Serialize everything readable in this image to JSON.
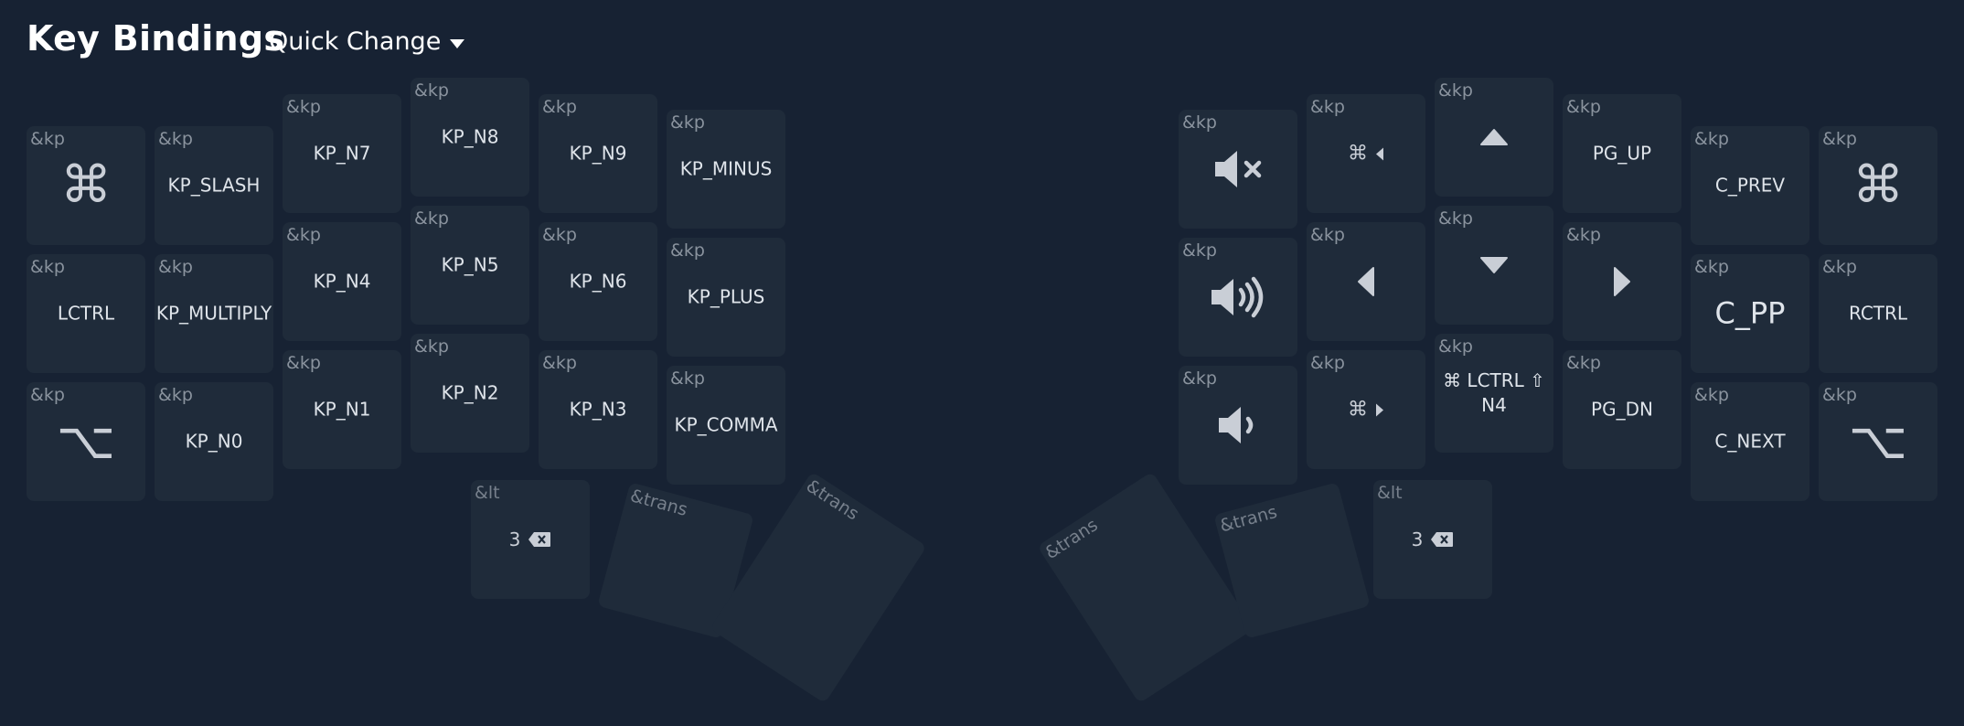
{
  "header": {
    "title": "Key Bindings",
    "quick_change": "Quick Change"
  },
  "keys": {
    "l_r0c0": {
      "bind": "&kp",
      "icon": "command-icon"
    },
    "l_r0c1": {
      "bind": "&kp",
      "label": "KP_SLASH"
    },
    "l_r0c2": {
      "bind": "&kp",
      "label": "KP_N7"
    },
    "l_r0c3": {
      "bind": "&kp",
      "label": "KP_N8"
    },
    "l_r0c4": {
      "bind": "&kp",
      "label": "KP_N9"
    },
    "l_r0c5": {
      "bind": "&kp",
      "label": "KP_MINUS"
    },
    "l_r1c0": {
      "bind": "&kp",
      "label": "LCTRL"
    },
    "l_r1c1": {
      "bind": "&kp",
      "label": "KP_MULTIPLY"
    },
    "l_r1c2": {
      "bind": "&kp",
      "label": "KP_N4"
    },
    "l_r1c3": {
      "bind": "&kp",
      "label": "KP_N5"
    },
    "l_r1c4": {
      "bind": "&kp",
      "label": "KP_N6"
    },
    "l_r1c5": {
      "bind": "&kp",
      "label": "KP_PLUS"
    },
    "l_r2c0": {
      "bind": "&kp",
      "icon": "option-icon"
    },
    "l_r2c1": {
      "bind": "&kp",
      "label": "KP_N0"
    },
    "l_r2c2": {
      "bind": "&kp",
      "label": "KP_N1"
    },
    "l_r2c3": {
      "bind": "&kp",
      "label": "KP_N2"
    },
    "l_r2c4": {
      "bind": "&kp",
      "label": "KP_N3"
    },
    "l_r2c5": {
      "bind": "&kp",
      "label": "KP_COMMA"
    },
    "l_t0": {
      "bind": "&lt",
      "label": "3",
      "icon": "backspace-icon"
    },
    "l_t1": {
      "bind": "&trans"
    },
    "l_t2": {
      "bind": "&trans"
    },
    "r_r0c0": {
      "bind": "&kp",
      "icon": "mute-icon"
    },
    "r_r0c1": {
      "bind": "&kp",
      "icon": "command-icon",
      "icon2": "caret-left-icon"
    },
    "r_r0c2": {
      "bind": "&kp",
      "icon": "caret-up-icon"
    },
    "r_r0c3": {
      "bind": "&kp",
      "label": "PG_UP"
    },
    "r_r0c4": {
      "bind": "&kp",
      "label": "C_PREV"
    },
    "r_r0c5": {
      "bind": "&kp",
      "icon": "command-icon"
    },
    "r_r1c0": {
      "bind": "&kp",
      "icon": "volume-up-icon"
    },
    "r_r1c1": {
      "bind": "&kp",
      "icon": "caret-left-icon"
    },
    "r_r1c2": {
      "bind": "&kp",
      "icon": "caret-down-icon"
    },
    "r_r1c3": {
      "bind": "&kp",
      "icon": "caret-right-icon"
    },
    "r_r1c4": {
      "bind": "&kp",
      "label": "C_PP"
    },
    "r_r1c5": {
      "bind": "&kp",
      "label": "RCTRL"
    },
    "r_r2c0": {
      "bind": "&kp",
      "icon": "volume-down-icon"
    },
    "r_r2c1": {
      "bind": "&kp",
      "icon": "command-icon",
      "icon2": "caret-right-icon"
    },
    "r_r2c2": {
      "bind": "&kp",
      "label": "⌘ LCTRL ⇧",
      "label2": "N4"
    },
    "r_r2c3": {
      "bind": "&kp",
      "label": "PG_DN"
    },
    "r_r2c4": {
      "bind": "&kp",
      "label": "C_NEXT"
    },
    "r_r2c5": {
      "bind": "&kp",
      "icon": "option-icon"
    },
    "r_t0": {
      "bind": "&trans"
    },
    "r_t1": {
      "bind": "&trans"
    },
    "r_t2": {
      "bind": "&lt",
      "label": "3",
      "icon": "backspace-icon"
    }
  }
}
